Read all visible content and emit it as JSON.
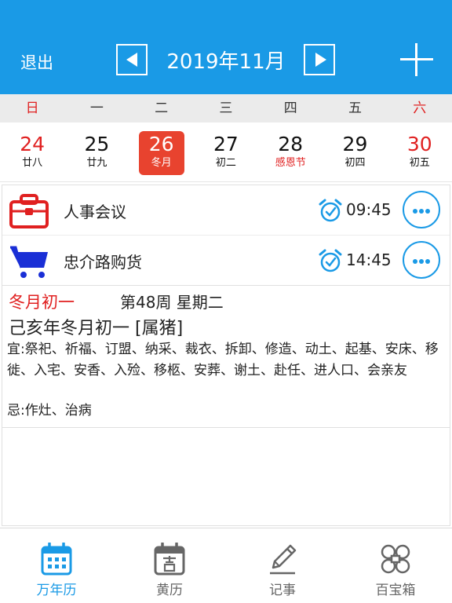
{
  "header": {
    "exit_label": "退出",
    "month_title": "2019年11月"
  },
  "weekdays": [
    "日",
    "一",
    "二",
    "三",
    "四",
    "五",
    "六"
  ],
  "dates": [
    {
      "day": "24",
      "lunar": "廿八"
    },
    {
      "day": "25",
      "lunar": "廿九"
    },
    {
      "day": "26",
      "lunar": "冬月"
    },
    {
      "day": "27",
      "lunar": "初二"
    },
    {
      "day": "28",
      "lunar": "感恩节"
    },
    {
      "day": "29",
      "lunar": "初四"
    },
    {
      "day": "30",
      "lunar": "初五"
    }
  ],
  "selected_day": "26",
  "events": [
    {
      "title": "人事会议",
      "time": "09:45",
      "icon": "briefcase-icon"
    },
    {
      "title": "忠介路购货",
      "time": "14:45",
      "icon": "shopping-cart-icon"
    }
  ],
  "almanac": {
    "lunar_date": "冬月初一",
    "week_info": "第48周 星期二",
    "ganzhi": "己亥年冬月初一 [属猪]",
    "yi": "宜:祭祀、祈福、订盟、纳采、裁衣、拆卸、修造、动土、起基、安床、移徙、入宅、安香、入殓、移柩、安葬、谢土、赴任、进人口、会亲友",
    "ji": "忌:作灶、治病"
  },
  "tabs": [
    {
      "label": "万年历",
      "icon": "calendar-grid-icon"
    },
    {
      "label": "黄历",
      "icon": "almanac-calendar-icon"
    },
    {
      "label": "记事",
      "icon": "pencil-icon"
    },
    {
      "label": "百宝箱",
      "icon": "clover-icon"
    }
  ],
  "active_tab": "万年历",
  "colors": {
    "primary": "#1a9ae6",
    "accent_red": "#e02020",
    "selected_bg": "#e8432f",
    "cart_blue": "#1a2fd6"
  }
}
